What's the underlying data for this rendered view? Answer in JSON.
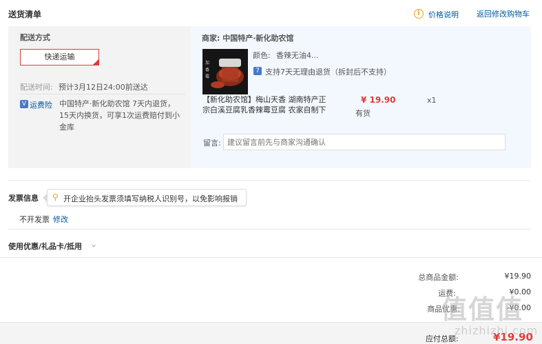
{
  "header": {
    "title": "送货清单",
    "price_note": "价格说明",
    "back_to_cart": "返回修改购物车",
    "info_icon": "i"
  },
  "shipping": {
    "label": "配送方式",
    "method": "快递运输",
    "time_label": "配送时间:",
    "time_value": "预计3月12日24:00前送达",
    "insurance_label": "运费险",
    "insurance_text": "中国特产·新化助农馆 7天内退货，15天内换货，可享1次运费赔付到小金库"
  },
  "order": {
    "shop": "商家:  中国特产·新化助农馆",
    "color_label": "颜色:",
    "color_value": "香辣无油4...",
    "return_policy": "支持7天无理由退货（拆封后不支持）",
    "product_title": "【新化助农馆】梅山天香 湖南特产正宗白溪豆腐乳香辣霉豆腐 农家自制下",
    "price": "¥ 19.90",
    "stock": "有货",
    "qty": "x1",
    "message_label": "留言:",
    "message_placeholder": "建议留言前先与商家沟通确认"
  },
  "invoice": {
    "label": "发票信息",
    "tip": "开企业抬头发票须填写纳税人识别号，以免影响报销",
    "value": "不开发票",
    "edit": "修改"
  },
  "coupon": {
    "label": "使用优惠/礼品卡/抵用"
  },
  "summary": {
    "goods_label": "总商品金额:",
    "goods_value": "¥19.90",
    "freight_label": "运费:",
    "freight_value": "¥0.00",
    "discount_label": "商品优惠:",
    "discount_value": "-¥0.00",
    "payable_label": "应付总额:",
    "payable_value": "¥19.90"
  },
  "watermark": {
    "text": "值值值",
    "sub": "zhizhizhi.com"
  },
  "colors": {
    "accent_red": "#e4393c",
    "link_blue": "#005aa0"
  }
}
